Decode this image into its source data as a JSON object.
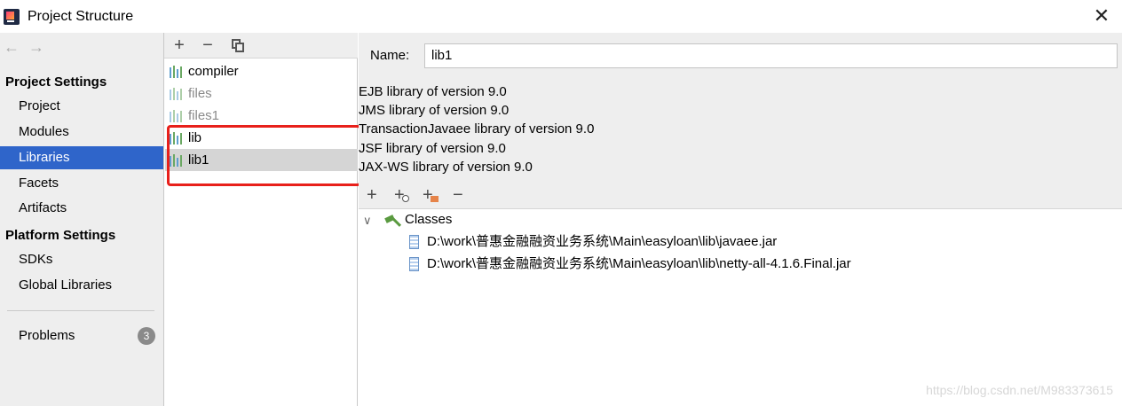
{
  "window": {
    "title": "Project Structure",
    "close_glyph": "✕"
  },
  "sidebar": {
    "nav_back": "←",
    "nav_forward": "→",
    "section_project": "Project Settings",
    "project_items": [
      "Project",
      "Modules",
      "Libraries",
      "Facets",
      "Artifacts"
    ],
    "selected": "Libraries",
    "section_platform": "Platform Settings",
    "platform_items": [
      "SDKs",
      "Global Libraries"
    ],
    "problems": {
      "label": "Problems",
      "count": "3"
    }
  },
  "libraries_list": {
    "toolbar": {
      "add": "+",
      "remove": "−"
    },
    "items": [
      {
        "label": "compiler",
        "dim": false
      },
      {
        "label": "files",
        "dim": true
      },
      {
        "label": "files1",
        "dim": true
      },
      {
        "label": "lib",
        "dim": false
      },
      {
        "label": "lib1",
        "dim": false,
        "selected": true
      }
    ]
  },
  "details": {
    "name_label": "Name:",
    "name_value": "lib1",
    "descriptions": [
      "EJB library of version 9.0",
      "JMS library of version 9.0",
      "TransactionJavaee library of version 9.0",
      "JSF library of version 9.0",
      "JAX-WS library of version 9.0"
    ],
    "toolbar": {
      "add": "+",
      "add_specific": "+",
      "add_jar": "+",
      "remove": "−"
    },
    "tree": {
      "expand_glyph": "∨",
      "classes_label": "Classes",
      "jars": [
        "D:\\work\\普惠金融融资业务系统\\Main\\easyloan\\lib\\javaee.jar",
        "D:\\work\\普惠金融融资业务系统\\Main\\easyloan\\lib\\netty-all-4.1.6.Final.jar"
      ]
    }
  },
  "watermark": "https://blog.csdn.net/M983373615",
  "colors": {
    "selection": "#2f65ca",
    "highlight_box": "#e8201b",
    "panel_bg": "#eeeeee"
  }
}
